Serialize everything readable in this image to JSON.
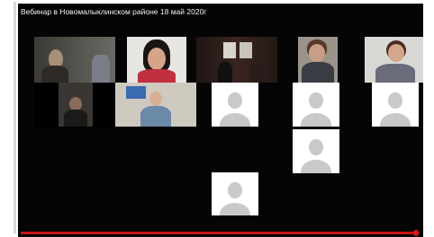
{
  "video": {
    "title": "Вебинар в Новомалыклинском районе 18 май 2020г",
    "progress_fraction": 0.99
  },
  "colors": {
    "background": "#050505",
    "progress": "#c81414"
  }
}
